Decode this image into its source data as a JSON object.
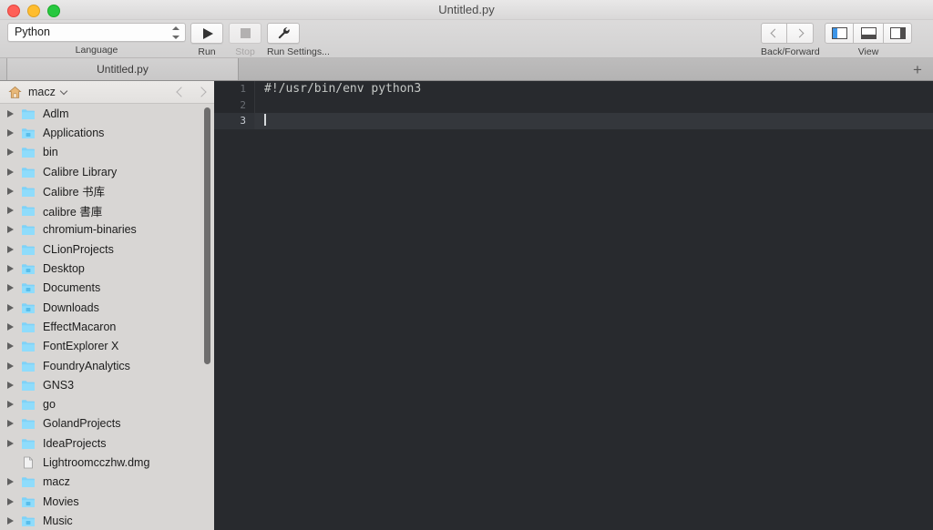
{
  "window": {
    "title": "Untitled.py",
    "traffic_lights": [
      {
        "name": "close",
        "color": "#ff5f57"
      },
      {
        "name": "minimize",
        "color": "#ffbd2e"
      },
      {
        "name": "maximize",
        "color": "#28c840"
      }
    ]
  },
  "toolbar": {
    "language": {
      "value": "Python",
      "label": "Language",
      "icon": "stepper-updown-icon"
    },
    "run": {
      "label": "Run",
      "icon": "play-icon",
      "enabled": true
    },
    "stop": {
      "label": "Stop",
      "icon": "stop-square-icon",
      "enabled": false
    },
    "run_settings": {
      "label": "Run Settings...",
      "icon": "wrench-icon",
      "enabled": true
    },
    "navigation": {
      "label": "Back/Forward",
      "back_icon": "chevron-left-icon",
      "forward_icon": "chevron-right-icon"
    },
    "view": {
      "label": "View",
      "options": [
        {
          "name": "left-sidebar-layout",
          "icon": "panel-left-icon",
          "active": true
        },
        {
          "name": "bottom-panel-layout",
          "icon": "panel-bottom-icon",
          "active": false
        },
        {
          "name": "right-panel-layout",
          "icon": "panel-right-icon",
          "active": false
        }
      ],
      "accent_color": "#3d95e8"
    }
  },
  "tabbar": {
    "tabs": [
      {
        "label": "Untitled.py",
        "active": true
      }
    ],
    "add_tab_label": "+"
  },
  "sidebar": {
    "header": {
      "icon": "home-icon",
      "label": "macz",
      "chevron": "chevron-down-icon",
      "back_icon": "chevron-left-icon",
      "forward_icon": "chevron-right-icon"
    },
    "items": [
      {
        "label": "Adlm",
        "type": "folder",
        "expandable": true
      },
      {
        "label": "Applications",
        "type": "folder-applications",
        "expandable": true
      },
      {
        "label": "bin",
        "type": "folder",
        "expandable": true
      },
      {
        "label": "Calibre Library",
        "type": "folder",
        "expandable": true
      },
      {
        "label": "Calibre 书库",
        "type": "folder",
        "expandable": true
      },
      {
        "label": "calibre 書庫",
        "type": "folder",
        "expandable": true
      },
      {
        "label": "chromium-binaries",
        "type": "folder",
        "expandable": true
      },
      {
        "label": "CLionProjects",
        "type": "folder",
        "expandable": true
      },
      {
        "label": "Desktop",
        "type": "folder-desktop",
        "expandable": true
      },
      {
        "label": "Documents",
        "type": "folder-documents",
        "expandable": true
      },
      {
        "label": "Downloads",
        "type": "folder-downloads",
        "expandable": true
      },
      {
        "label": "EffectMacaron",
        "type": "folder",
        "expandable": true
      },
      {
        "label": "FontExplorer X",
        "type": "folder",
        "expandable": true
      },
      {
        "label": "FoundryAnalytics",
        "type": "folder",
        "expandable": true
      },
      {
        "label": "GNS3",
        "type": "folder",
        "expandable": true
      },
      {
        "label": "go",
        "type": "folder",
        "expandable": true
      },
      {
        "label": "GolandProjects",
        "type": "folder",
        "expandable": true
      },
      {
        "label": "IdeaProjects",
        "type": "folder",
        "expandable": true
      },
      {
        "label": "Lightroomcczhw.dmg",
        "type": "file-disk-image",
        "expandable": false
      },
      {
        "label": "macz",
        "type": "folder",
        "expandable": true
      },
      {
        "label": "Movies",
        "type": "folder-movies",
        "expandable": true
      },
      {
        "label": "Music",
        "type": "folder-music",
        "expandable": true
      }
    ]
  },
  "editor": {
    "background": "#282a2e",
    "lines": [
      {
        "number": "1",
        "code": "#!/usr/bin/env python3",
        "current": false
      },
      {
        "number": "2",
        "code": "",
        "current": false
      },
      {
        "number": "3",
        "code": "",
        "current": true
      }
    ]
  }
}
